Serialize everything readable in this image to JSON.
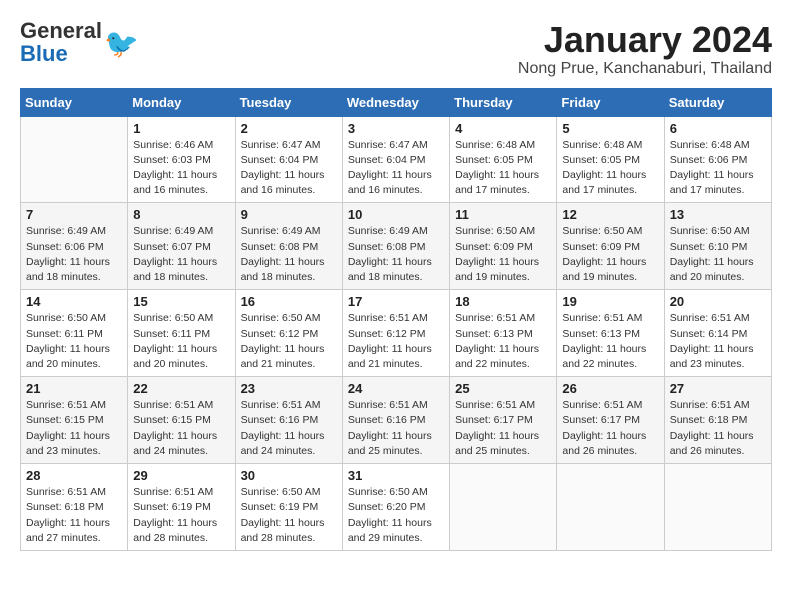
{
  "header": {
    "logo_general": "General",
    "logo_blue": "Blue",
    "main_title": "January 2024",
    "sub_title": "Nong Prue, Kanchanaburi, Thailand"
  },
  "calendar": {
    "days_of_week": [
      "Sunday",
      "Monday",
      "Tuesday",
      "Wednesday",
      "Thursday",
      "Friday",
      "Saturday"
    ],
    "weeks": [
      [
        {
          "day": "",
          "info": ""
        },
        {
          "day": "1",
          "info": "Sunrise: 6:46 AM\nSunset: 6:03 PM\nDaylight: 11 hours\nand 16 minutes."
        },
        {
          "day": "2",
          "info": "Sunrise: 6:47 AM\nSunset: 6:04 PM\nDaylight: 11 hours\nand 16 minutes."
        },
        {
          "day": "3",
          "info": "Sunrise: 6:47 AM\nSunset: 6:04 PM\nDaylight: 11 hours\nand 16 minutes."
        },
        {
          "day": "4",
          "info": "Sunrise: 6:48 AM\nSunset: 6:05 PM\nDaylight: 11 hours\nand 17 minutes."
        },
        {
          "day": "5",
          "info": "Sunrise: 6:48 AM\nSunset: 6:05 PM\nDaylight: 11 hours\nand 17 minutes."
        },
        {
          "day": "6",
          "info": "Sunrise: 6:48 AM\nSunset: 6:06 PM\nDaylight: 11 hours\nand 17 minutes."
        }
      ],
      [
        {
          "day": "7",
          "info": "Sunrise: 6:49 AM\nSunset: 6:06 PM\nDaylight: 11 hours\nand 18 minutes."
        },
        {
          "day": "8",
          "info": "Sunrise: 6:49 AM\nSunset: 6:07 PM\nDaylight: 11 hours\nand 18 minutes."
        },
        {
          "day": "9",
          "info": "Sunrise: 6:49 AM\nSunset: 6:08 PM\nDaylight: 11 hours\nand 18 minutes."
        },
        {
          "day": "10",
          "info": "Sunrise: 6:49 AM\nSunset: 6:08 PM\nDaylight: 11 hours\nand 18 minutes."
        },
        {
          "day": "11",
          "info": "Sunrise: 6:50 AM\nSunset: 6:09 PM\nDaylight: 11 hours\nand 19 minutes."
        },
        {
          "day": "12",
          "info": "Sunrise: 6:50 AM\nSunset: 6:09 PM\nDaylight: 11 hours\nand 19 minutes."
        },
        {
          "day": "13",
          "info": "Sunrise: 6:50 AM\nSunset: 6:10 PM\nDaylight: 11 hours\nand 20 minutes."
        }
      ],
      [
        {
          "day": "14",
          "info": "Sunrise: 6:50 AM\nSunset: 6:11 PM\nDaylight: 11 hours\nand 20 minutes."
        },
        {
          "day": "15",
          "info": "Sunrise: 6:50 AM\nSunset: 6:11 PM\nDaylight: 11 hours\nand 20 minutes."
        },
        {
          "day": "16",
          "info": "Sunrise: 6:50 AM\nSunset: 6:12 PM\nDaylight: 11 hours\nand 21 minutes."
        },
        {
          "day": "17",
          "info": "Sunrise: 6:51 AM\nSunset: 6:12 PM\nDaylight: 11 hours\nand 21 minutes."
        },
        {
          "day": "18",
          "info": "Sunrise: 6:51 AM\nSunset: 6:13 PM\nDaylight: 11 hours\nand 22 minutes."
        },
        {
          "day": "19",
          "info": "Sunrise: 6:51 AM\nSunset: 6:13 PM\nDaylight: 11 hours\nand 22 minutes."
        },
        {
          "day": "20",
          "info": "Sunrise: 6:51 AM\nSunset: 6:14 PM\nDaylight: 11 hours\nand 23 minutes."
        }
      ],
      [
        {
          "day": "21",
          "info": "Sunrise: 6:51 AM\nSunset: 6:15 PM\nDaylight: 11 hours\nand 23 minutes."
        },
        {
          "day": "22",
          "info": "Sunrise: 6:51 AM\nSunset: 6:15 PM\nDaylight: 11 hours\nand 24 minutes."
        },
        {
          "day": "23",
          "info": "Sunrise: 6:51 AM\nSunset: 6:16 PM\nDaylight: 11 hours\nand 24 minutes."
        },
        {
          "day": "24",
          "info": "Sunrise: 6:51 AM\nSunset: 6:16 PM\nDaylight: 11 hours\nand 25 minutes."
        },
        {
          "day": "25",
          "info": "Sunrise: 6:51 AM\nSunset: 6:17 PM\nDaylight: 11 hours\nand 25 minutes."
        },
        {
          "day": "26",
          "info": "Sunrise: 6:51 AM\nSunset: 6:17 PM\nDaylight: 11 hours\nand 26 minutes."
        },
        {
          "day": "27",
          "info": "Sunrise: 6:51 AM\nSunset: 6:18 PM\nDaylight: 11 hours\nand 26 minutes."
        }
      ],
      [
        {
          "day": "28",
          "info": "Sunrise: 6:51 AM\nSunset: 6:18 PM\nDaylight: 11 hours\nand 27 minutes."
        },
        {
          "day": "29",
          "info": "Sunrise: 6:51 AM\nSunset: 6:19 PM\nDaylight: 11 hours\nand 28 minutes."
        },
        {
          "day": "30",
          "info": "Sunrise: 6:50 AM\nSunset: 6:19 PM\nDaylight: 11 hours\nand 28 minutes."
        },
        {
          "day": "31",
          "info": "Sunrise: 6:50 AM\nSunset: 6:20 PM\nDaylight: 11 hours\nand 29 minutes."
        },
        {
          "day": "",
          "info": ""
        },
        {
          "day": "",
          "info": ""
        },
        {
          "day": "",
          "info": ""
        }
      ]
    ]
  }
}
